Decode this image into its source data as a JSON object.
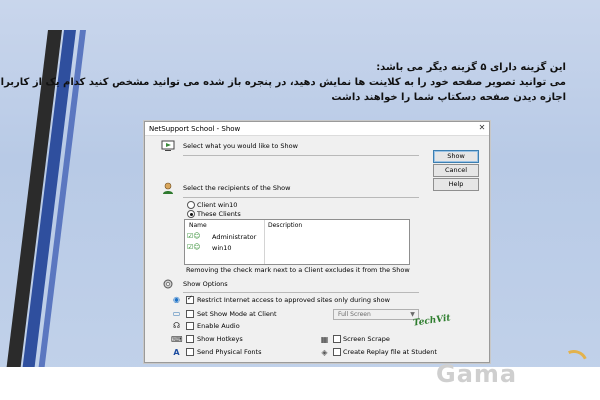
{
  "slide": {
    "lines": [
      "این گزینه دارای ۵ گزینه دیگر می باشد:",
      "می توانید تصویر صفحه خود را به کلاینت ها نمایش دهید، در پنجره باز شده می توانید مشخص کنید کدام یک از کاربران",
      "اجازه دیدن صفحه دسکتاپ شما را خواهند داشت"
    ],
    "watermark": "Gama"
  },
  "dialog": {
    "title": "NetSupport School - Show",
    "close": "✕",
    "section_show": "Select what you would like to Show",
    "section_recipients": "Select the recipients of the Show",
    "buttons": {
      "show": "Show",
      "cancel": "Cancel",
      "help": "Help"
    },
    "radio_client": "Client win10",
    "radio_these": "These Clients",
    "list": {
      "col_name": "Name",
      "col_description": "Description",
      "rows": [
        {
          "name": "Administrator"
        },
        {
          "name": "win10"
        }
      ]
    },
    "note": "Removing the check mark next to a Client excludes it from the Show",
    "section_options": "Show Options",
    "options": {
      "restrict": "Restrict Internet access to approved sites only during show",
      "show_mode": "Set Show Mode at Client",
      "show_mode_value": "Full Screen",
      "enable_audio": "Enable Audio",
      "show_hotkeys": "Show Hotkeys",
      "screen_scrape": "Screen Scrape",
      "send_fonts": "Send Physical Fonts",
      "replay": "Create Replay file at Student"
    },
    "brand": "TechVit"
  }
}
